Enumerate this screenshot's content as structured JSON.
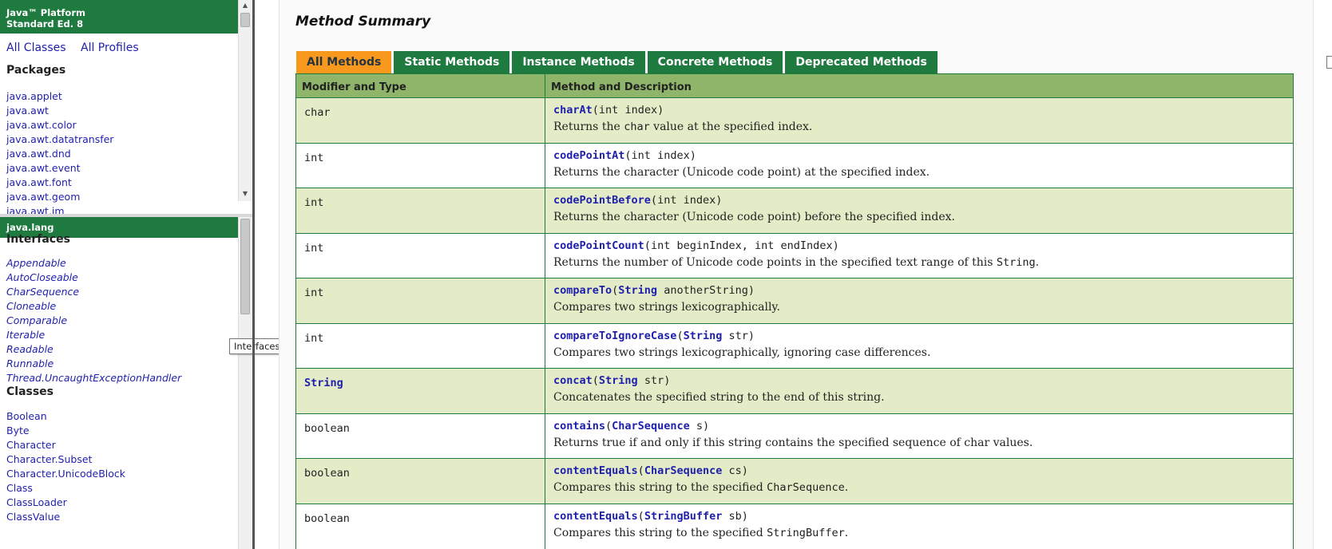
{
  "brand": {
    "line1": "Java™ Platform",
    "line2": "Standard Ed. 8"
  },
  "top_links": {
    "all_classes": "All Classes",
    "all_profiles": "All Profiles"
  },
  "packages": {
    "heading": "Packages",
    "items": [
      "java.applet",
      "java.awt",
      "java.awt.color",
      "java.awt.datatransfer",
      "java.awt.dnd",
      "java.awt.event",
      "java.awt.font",
      "java.awt.geom",
      "java.awt.im"
    ]
  },
  "package_frame": {
    "title": "java.lang",
    "interfaces_heading": "Interfaces",
    "interfaces": [
      "Appendable",
      "AutoCloseable",
      "CharSequence",
      "Cloneable",
      "Comparable",
      "Iterable",
      "Readable",
      "Runnable",
      "Thread.UncaughtExceptionHandler"
    ],
    "classes_heading": "Classes",
    "classes": [
      "Boolean",
      "Byte",
      "Character",
      "Character.Subset",
      "Character.UnicodeBlock",
      "Class",
      "ClassLoader",
      "ClassValue"
    ]
  },
  "tooltip": "Interfaces",
  "main": {
    "section_title": "Method Summary",
    "tabs": [
      "All Methods",
      "Static Methods",
      "Instance Methods",
      "Concrete Methods",
      "Deprecated Methods"
    ],
    "active_tab": "All Methods",
    "table_headers": [
      "Modifier and Type",
      "Method and Description"
    ],
    "rows": [
      {
        "type": "char",
        "method": "charAt",
        "params": [
          {
            "t": "int",
            "n": "index"
          }
        ],
        "desc": [
          "Returns the ",
          "char",
          " value at the specified index."
        ]
      },
      {
        "type": "int",
        "method": "codePointAt",
        "params": [
          {
            "t": "int",
            "n": "index"
          }
        ],
        "desc": [
          "Returns the character (Unicode code point) at the specified index."
        ]
      },
      {
        "type": "int",
        "method": "codePointBefore",
        "params": [
          {
            "t": "int",
            "n": "index"
          }
        ],
        "desc": [
          "Returns the character (Unicode code point) before the specified index."
        ]
      },
      {
        "type": "int",
        "method": "codePointCount",
        "params": [
          {
            "t": "int",
            "n": "beginIndex"
          },
          {
            "t": "int",
            "n": "endIndex"
          }
        ],
        "desc": [
          "Returns the number of Unicode code points in the specified text range of this ",
          "String",
          "."
        ]
      },
      {
        "type": "int",
        "method": "compareTo",
        "params": [
          {
            "t": "String",
            "n": "anotherString",
            "link": true
          }
        ],
        "desc": [
          "Compares two strings lexicographically."
        ]
      },
      {
        "type": "int",
        "method": "compareToIgnoreCase",
        "params": [
          {
            "t": "String",
            "n": "str",
            "link": true
          }
        ],
        "desc": [
          "Compares two strings lexicographically, ignoring case differences."
        ]
      },
      {
        "type": "String",
        "type_link": true,
        "method": "concat",
        "params": [
          {
            "t": "String",
            "n": "str",
            "link": true
          }
        ],
        "desc": [
          "Concatenates the specified string to the end of this string."
        ]
      },
      {
        "type": "boolean",
        "method": "contains",
        "params": [
          {
            "t": "CharSequence",
            "n": "s",
            "link": true
          }
        ],
        "desc": [
          "Returns true if and only if this string contains the specified sequence of char values."
        ]
      },
      {
        "type": "boolean",
        "method": "contentEquals",
        "params": [
          {
            "t": "CharSequence",
            "n": "cs",
            "link": true
          }
        ],
        "desc": [
          "Compares this string to the specified ",
          "CharSequence",
          "."
        ]
      },
      {
        "type": "boolean",
        "method": "contentEquals",
        "params": [
          {
            "t": "StringBuffer",
            "n": "sb",
            "link": true
          }
        ],
        "desc": [
          "Compares this string to the specified ",
          "StringBuffer",
          "."
        ]
      }
    ]
  },
  "colors": {
    "brand_green": "#1f7a3f",
    "active_tab": "#f8981d",
    "row_alt": "#e3ecc7",
    "header": "#8fb56a",
    "link": "#1f1fad"
  }
}
